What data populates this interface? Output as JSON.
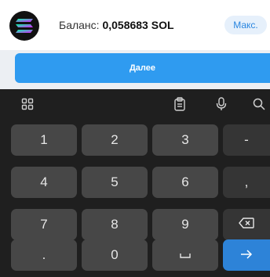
{
  "balance": {
    "label": "Баланс:",
    "amount": "0,058683 SOL",
    "max_label": "Макс."
  },
  "next_label": "Далее",
  "keyboard": {
    "toolbar_icons": [
      "grid-icon",
      "clipboard-icon",
      "microphone-icon",
      "search-icon"
    ],
    "keys": {
      "k1": "1",
      "k2": "2",
      "k3": "3",
      "minus": "-",
      "k4": "4",
      "k5": "5",
      "k6": "6",
      "comma": ",",
      "k7": "7",
      "k8": "8",
      "k9": "9",
      "backspace": "⌫",
      "period": ".",
      "k0": "0",
      "space": "␣",
      "enter": "→"
    }
  },
  "colors": {
    "accent": "#2f9bf0",
    "max_badge_bg": "#e6f0fb",
    "keyboard_bg": "#1f1f1f",
    "key_bg": "#474747",
    "enter_key": "#2d83d8"
  }
}
